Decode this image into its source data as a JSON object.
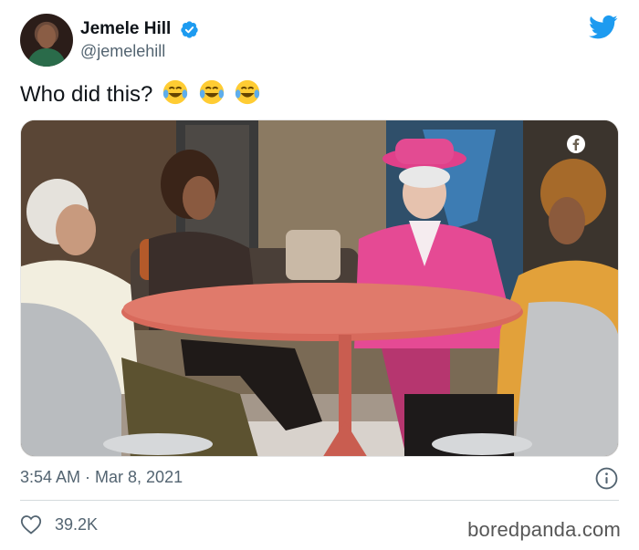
{
  "author": {
    "name": "Jemele Hill",
    "handle": "@jemelehill",
    "verified": true
  },
  "tweet": {
    "text": "Who did this?",
    "emojis": [
      "face-with-tears-of-joy",
      "face-with-tears-of-joy",
      "face-with-tears-of-joy"
    ]
  },
  "media": {
    "overlay_icon": "facebook-icon"
  },
  "meta": {
    "timestamp": "3:54 AM · Mar 8, 2021"
  },
  "engagement": {
    "likes": "39.2K"
  },
  "watermark": "boredpanda.com",
  "colors": {
    "twitter_blue": "#1d9bf0",
    "secondary_text": "#536471",
    "divider": "#d5dadd"
  }
}
